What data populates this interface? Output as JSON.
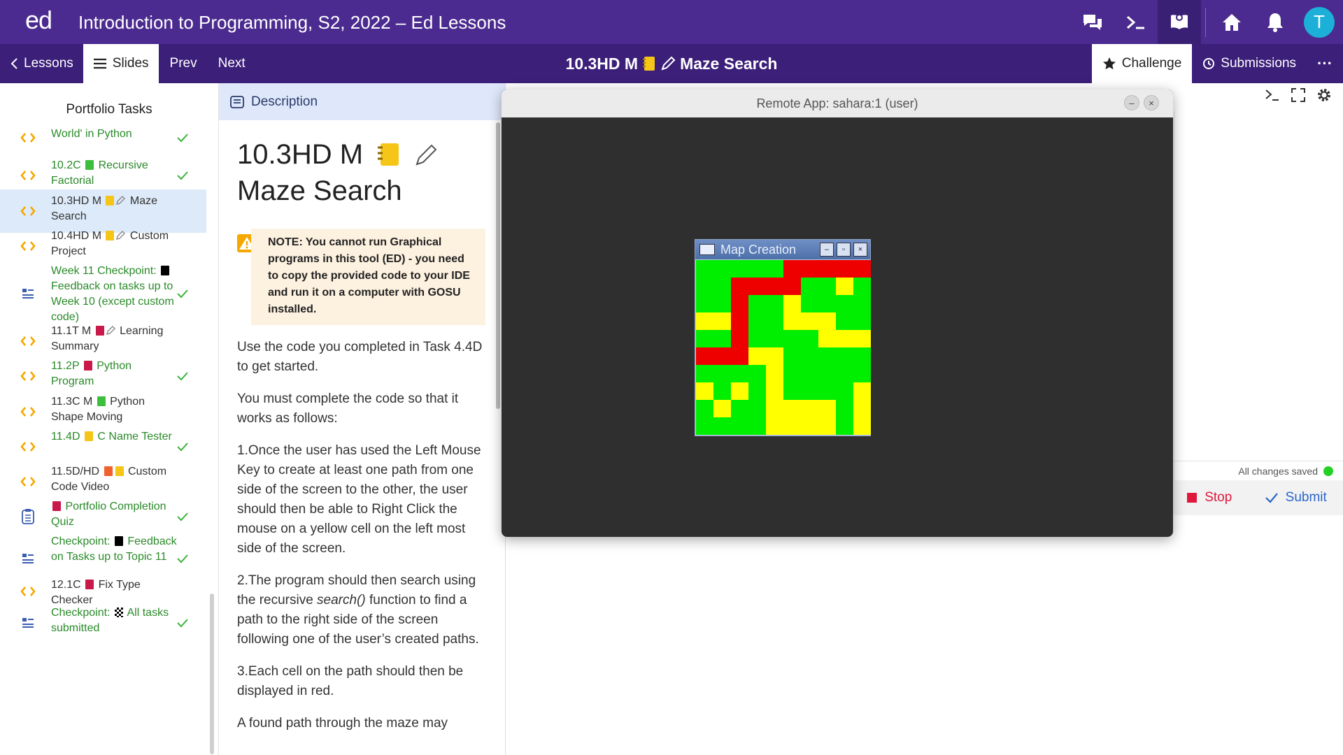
{
  "topbar": {
    "logo": "ed",
    "title": "Introduction to Programming, S2, 2022 – Ed Lessons",
    "avatar_initial": "T",
    "icons": [
      "discussion-icon",
      "terminal-icon",
      "lessons-icon",
      "home-icon",
      "bell-icon"
    ]
  },
  "nav": {
    "lessons": "Lessons",
    "slides": "Slides",
    "prev": "Prev",
    "next": "Next",
    "title_code": "10.3HD M",
    "title_name": "Maze Search",
    "challenge": "Challenge",
    "submissions": "Submissions",
    "more": "···"
  },
  "sidebar": {
    "heading": "Portfolio Tasks",
    "items": [
      {
        "text": "World' in Python",
        "icon": "code-icon",
        "done": true
      },
      {
        "code": "10.2C",
        "text": "Recursive Factorial",
        "icon": "code-icon",
        "done": true,
        "square": "#3cbf3c"
      },
      {
        "code": "10.3HD M",
        "text": "Maze Search",
        "icon": "code-icon",
        "done": false,
        "square": "#f5c518",
        "pen": true
      },
      {
        "code": "10.4HD M",
        "text": "Custom Project",
        "icon": "code-icon",
        "done": false,
        "square": "#f5c518",
        "pen": true
      },
      {
        "pre": "Week 11 Checkpoint:",
        "text": "Feedback on tasks up to Week 10 (except custom code)",
        "icon": "checkpoint-icon",
        "done": true,
        "square": "#000000"
      },
      {
        "code": "11.1T M",
        "text": "Learning Summary",
        "icon": "code-icon",
        "done": false,
        "square": "#c8194a",
        "pen": true
      },
      {
        "code": "11.2P",
        "text": "Python Program",
        "icon": "code-icon",
        "done": true,
        "square": "#c8194a"
      },
      {
        "code": "11.3C M",
        "text": "Python Shape Moving",
        "icon": "code-icon",
        "done": false,
        "square": "#3cbf3c"
      },
      {
        "code": "11.4D",
        "text": "C Name Tester",
        "icon": "code-icon",
        "done": true,
        "square": "#f5c518"
      },
      {
        "code": "11.5D/HD",
        "text": "Custom Code Video",
        "icon": "code-icon",
        "done": false,
        "square": "#f0612b",
        "square2": "#f5c518"
      },
      {
        "text": "Portfolio Completion Quiz",
        "icon": "quiz-icon",
        "done": true,
        "square": "#c8194a"
      },
      {
        "pre": "Checkpoint:",
        "text": "Feedback on Tasks up to Topic 11",
        "icon": "checkpoint-icon",
        "done": true,
        "square": "#000000"
      },
      {
        "code": "12.1C",
        "text": "Fix Type Checker",
        "icon": "code-icon",
        "done": false,
        "square": "#c8194a"
      },
      {
        "pre": "Checkpoint:",
        "text": "All tasks submitted",
        "icon": "checkpoint-icon",
        "done": true,
        "checkered": true
      }
    ]
  },
  "description": {
    "header": "Description",
    "title_line1": "10.3HD M",
    "title_line2": "Maze Search",
    "note": "NOTE: You cannot run Graphical programs in this tool (ED) - you need to copy the provided code to your IDE and run it on a computer with GOSU installed.",
    "p1": "Use the code you completed in Task 4.4D to get started.",
    "p2": "You must complete the code so that it works as follows:",
    "p3": "1.Once the user has used the Left Mouse Key to create at least one path from one side of the screen to the other, the user should then be able to Right Click the mouse on a yellow cell on the left most side of the screen.",
    "p4_pre": "2.The program should then search using the recursive ",
    "p4_em": "search()",
    "p4_post": " function to find a path to the right side of the screen following one of the user’s created paths.",
    "p5": "3.Each cell on the path should then be displayed in red.",
    "p6": "A found path through the maze may"
  },
  "editor": {
    "saved": "All changes saved",
    "stop": "Stop",
    "submit": "Submit"
  },
  "remote_app": {
    "title": "Remote App: sahara:1 (user)",
    "minimize": "–",
    "close": "×"
  },
  "map_window": {
    "title": "Map Creation",
    "colors": {
      "G": "#00ee00",
      "R": "#ee0000",
      "Y": "#ffff00"
    },
    "grid": [
      "GGGGGRRRRR",
      "GGRRRRGGYG",
      "GGRGGYGGGG",
      "YYRGGYYYGG",
      "GGRGGGGYYY",
      "RRRYYGGGGG",
      "GGGGYGGGGG",
      "YGYGYGGGGY",
      "GYGGYYYYGY",
      "GGGGYYYYGY"
    ]
  },
  "accent_colors": {
    "brand_purple": "#4b2b8f",
    "nav_purple": "#3c1f79",
    "done_green": "#2a8a2a",
    "stop_red": "#e0183c",
    "submit_blue": "#2a66c9"
  }
}
